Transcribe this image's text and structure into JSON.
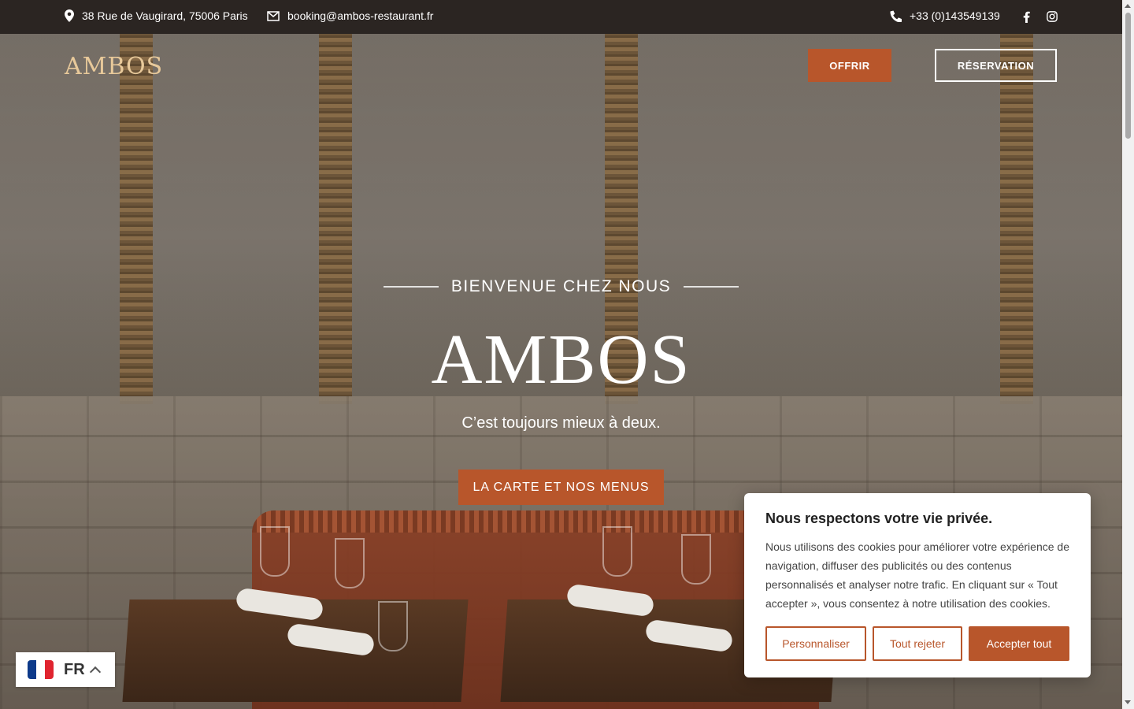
{
  "topbar": {
    "address": "38 Rue de Vaugirard, 75006 Paris",
    "email": "booking@ambos-restaurant.fr",
    "phone": "+33 (0)143549139",
    "icons": [
      "map-pin-icon",
      "envelope-icon",
      "phone-icon",
      "facebook-icon",
      "instagram-icon"
    ]
  },
  "header": {
    "logo": "AMBOS",
    "offrir_label": "OFFRIR",
    "reservation_label": "RÉSERVATION"
  },
  "hero": {
    "welcome": "BIENVENUE CHEZ NOUS",
    "title": "AMBOS",
    "tagline": "C’est toujours mieux à deux.",
    "cta_label": "LA CARTE ET NOS MENUS"
  },
  "cookie": {
    "title": "Nous respectons votre vie privée.",
    "body": "Nous utilisons des cookies pour améliorer votre expérience de navigation, diffuser des publicités ou des contenus personnalisés et analyser notre trafic. En cliquant sur « Tout accepter », vous consentez à notre utilisation des cookies.",
    "customize_label": "Personnaliser",
    "reject_label": "Tout rejeter",
    "accept_label": "Accepter tout"
  },
  "language": {
    "code": "FR",
    "flag": "france-flag-icon"
  },
  "colors": {
    "accent": "#b8562b",
    "topbar_bg": "#2b2522",
    "logo": "#e8c99a"
  }
}
